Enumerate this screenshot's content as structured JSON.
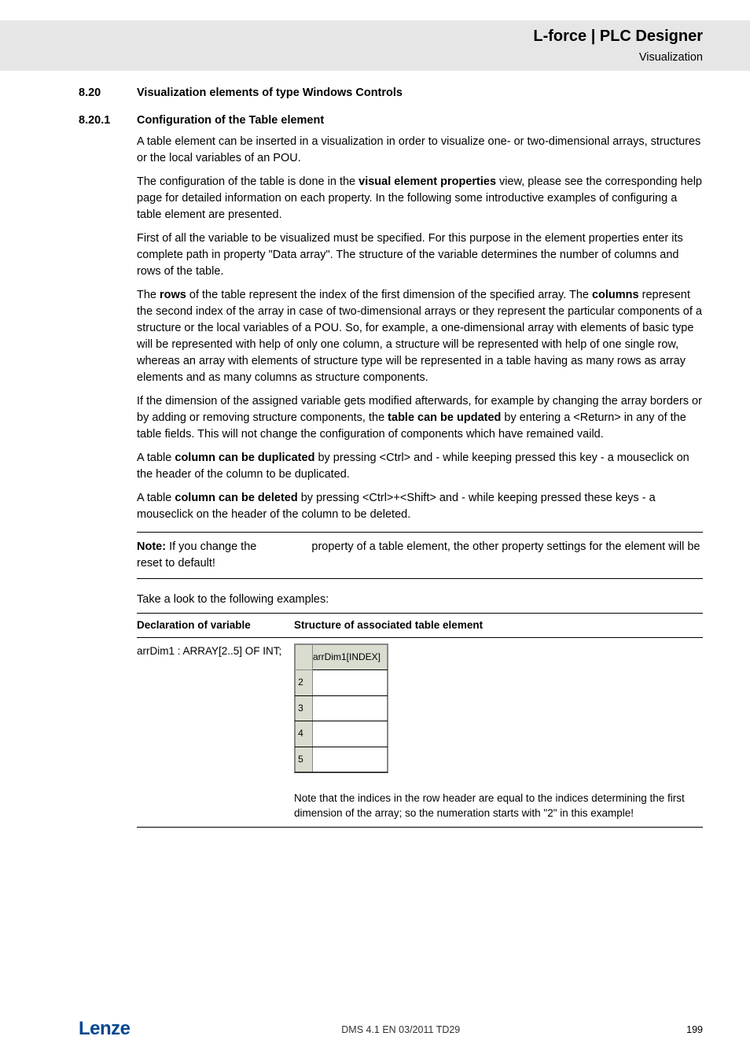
{
  "header": {
    "title": "L-force | PLC Designer",
    "sub": "Visualization"
  },
  "sec8_20": {
    "num": "8.20",
    "title": "Visualization elements of type Windows Controls"
  },
  "sec8_20_1": {
    "num": "8.20.1",
    "title": "Configuration of the Table element"
  },
  "para": {
    "p1": "A table element can be inserted in a visualization in order to visualize one- or two-dimensional arrays, structures or the local variables of an POU.",
    "p2a": "The configuration of the table is done in the ",
    "p2b": "visual element properties",
    "p2c": " view, please see the corresponding help page for detailed information on each property. In the following some introductive examples of configuring a table element are presented.",
    "p3": "First of all the variable to be visualized must be specified. For this purpose in the element properties enter its complete path in property \"Data array\". The structure of the variable determines the number of columns and rows of the table.",
    "p4a": "The ",
    "p4b": "rows",
    "p4c": " of the table represent the index of the first dimension of the specified array. The ",
    "p4d": "columns",
    "p4e": " represent the second index of the array in case of two-dimensional arrays or they represent the particular components of a structure or the local variables of a POU. So, for example,  a one-dimensional array with elements of basic type will be represented with help of only one column, a structure will be represented with help of one single row, whereas an array with elements of structure type will be represented in a table having as many rows as array elements and as many columns as structure components.",
    "p5a": "If the dimension of the assigned variable gets modified afterwards, for example by changing the array borders or by adding or removing structure components, the ",
    "p5b": "table can be updated",
    "p5c": " by entering a <Return> in any of the table fields. This will not change the configuration of components which have remained vaild.",
    "p6a": "A table ",
    "p6b": "column can be duplicated",
    "p6c": " by pressing <Ctrl> and  - while keeping pressed this key - a mouseclick on the header of the column to be duplicated.",
    "p7a": "A table ",
    "p7b": "column can be deleted",
    "p7c": " by pressing <Ctrl>+<Shift> and - while keeping pressed these keys - a mouseclick on the header of the column to be deleted."
  },
  "note": {
    "lead": "Note:",
    "text_a": " If you change the ",
    "text_b": " property of a table element, the other property settings for the element will be reset to default!"
  },
  "examples_intro": "Take a look to the following examples:",
  "table": {
    "h1": "Declaration of variable",
    "h2": "Structure of associated table element",
    "decl": "arrDim1 : ARRAY[2..5] OF INT;",
    "col_head": "arrDim1[INDEX]",
    "rows": [
      "2",
      "3",
      "4",
      "5"
    ],
    "note_under": "Note that the indices in the row header are equal to the indices determining the first dimension of the array; so the numeration starts with \"2\" in this example!"
  },
  "footer": {
    "logo": "Lenze",
    "center": "DMS 4.1 EN 03/2011 TD29",
    "page": "199"
  }
}
